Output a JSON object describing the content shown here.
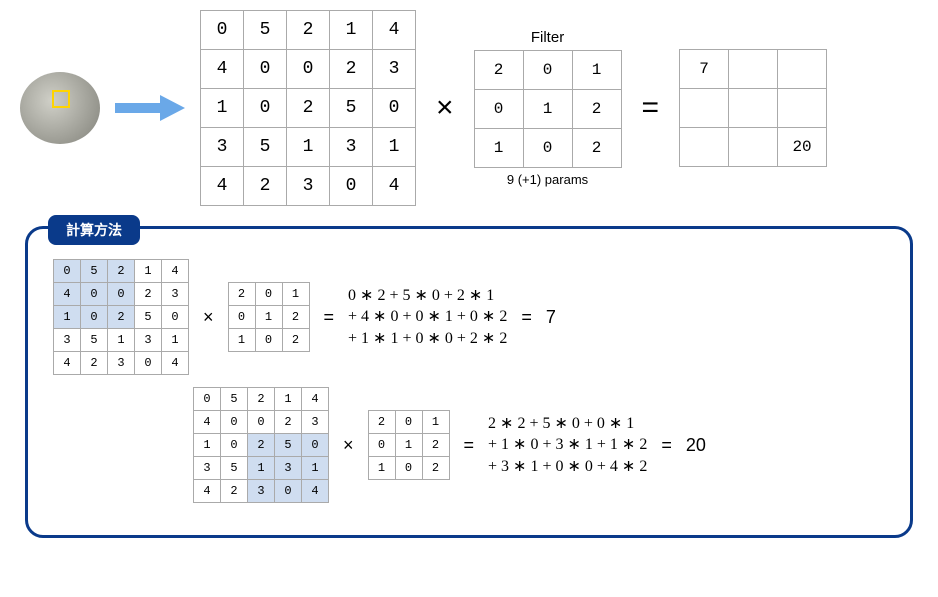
{
  "top": {
    "input": [
      [
        "0",
        "5",
        "2",
        "1",
        "4"
      ],
      [
        "4",
        "0",
        "0",
        "2",
        "3"
      ],
      [
        "1",
        "0",
        "2",
        "5",
        "0"
      ],
      [
        "3",
        "5",
        "1",
        "3",
        "1"
      ],
      [
        "4",
        "2",
        "3",
        "0",
        "4"
      ]
    ],
    "filter_title": "Filter",
    "filter": [
      [
        "2",
        "0",
        "1"
      ],
      [
        "0",
        "1",
        "2"
      ],
      [
        "1",
        "0",
        "2"
      ]
    ],
    "params": "9 (+1) params",
    "mult": "×",
    "eq": "=",
    "output": [
      [
        "7",
        "",
        ""
      ],
      [
        "",
        "",
        ""
      ],
      [
        "",
        "",
        "20"
      ]
    ]
  },
  "panel": {
    "title": "計算方法",
    "calc1": {
      "highlight": [
        [
          0,
          0
        ],
        [
          0,
          1
        ],
        [
          0,
          2
        ],
        [
          1,
          0
        ],
        [
          1,
          1
        ],
        [
          1,
          2
        ],
        [
          2,
          0
        ],
        [
          2,
          1
        ],
        [
          2,
          2
        ]
      ],
      "math_lines": [
        "0 ∗ 2 + 5 ∗ 0 + 2 ∗ 1",
        "+ 4 ∗ 0 + 0 ∗ 1 + 0 ∗ 2",
        "+ 1 ∗ 1 + 0 ∗ 0 + 2 ∗ 2"
      ],
      "result": "7"
    },
    "calc2": {
      "highlight": [
        [
          2,
          2
        ],
        [
          2,
          3
        ],
        [
          2,
          4
        ],
        [
          3,
          2
        ],
        [
          3,
          3
        ],
        [
          3,
          4
        ],
        [
          4,
          2
        ],
        [
          4,
          3
        ],
        [
          4,
          4
        ]
      ],
      "math_lines": [
        "2 ∗ 2 + 5 ∗ 0 + 0 ∗ 1",
        "+ 1 ∗ 0 + 3 ∗ 1 + 1 ∗ 2",
        "+ 3 ∗ 1 + 0 ∗ 0 + 4 ∗ 2"
      ],
      "result": "20"
    }
  }
}
